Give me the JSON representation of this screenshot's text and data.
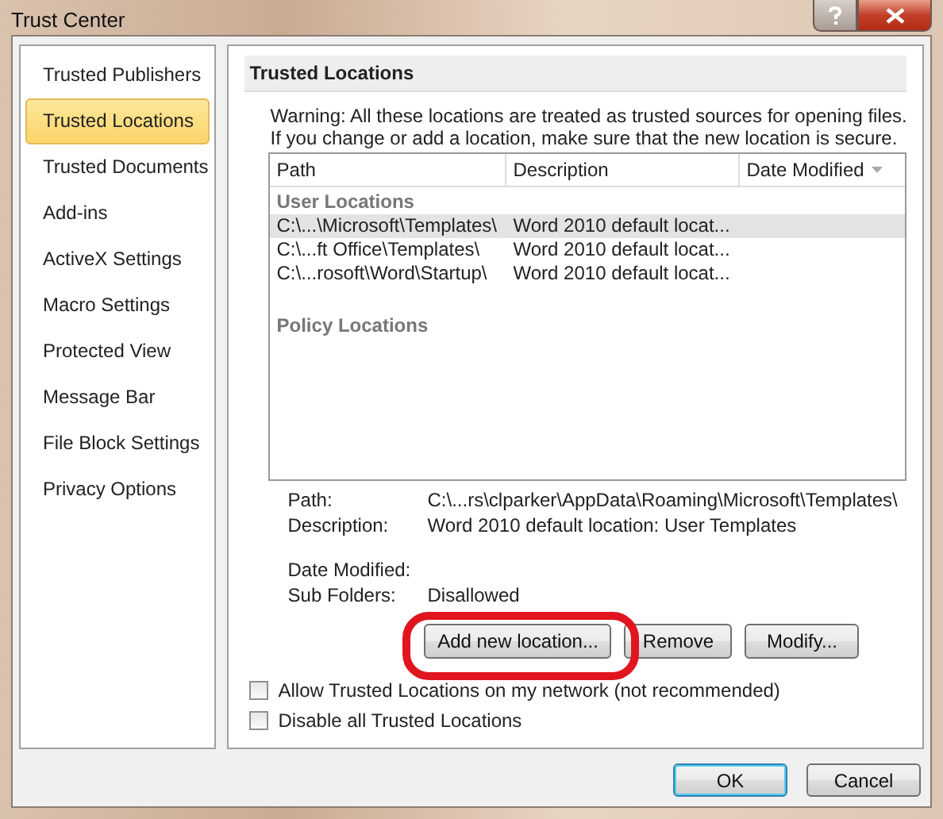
{
  "window": {
    "title": "Trust Center"
  },
  "sidebar": {
    "items": [
      {
        "label": "Trusted Publishers",
        "selected": false
      },
      {
        "label": "Trusted Locations",
        "selected": true
      },
      {
        "label": "Trusted Documents",
        "selected": false
      },
      {
        "label": "Add-ins",
        "selected": false
      },
      {
        "label": "ActiveX Settings",
        "selected": false
      },
      {
        "label": "Macro Settings",
        "selected": false
      },
      {
        "label": "Protected View",
        "selected": false
      },
      {
        "label": "Message Bar",
        "selected": false
      },
      {
        "label": "File Block Settings",
        "selected": false
      },
      {
        "label": "Privacy Options",
        "selected": false
      }
    ]
  },
  "section": {
    "title": "Trusted Locations",
    "warning": [
      "Warning: All these locations are treated as trusted sources for opening files.",
      "If you change or add a location, make sure that the new location is secure."
    ],
    "table": {
      "columns": [
        "Path",
        "Description",
        "Date Modified"
      ],
      "groups": [
        {
          "label": "User Locations",
          "rows": [
            {
              "path": "C:\\...\\Microsoft\\Templates\\",
              "description": "Word 2010 default locat...",
              "selected": true
            },
            {
              "path": "C:\\...ft Office\\Templates\\",
              "description": "Word 2010 default locat...",
              "selected": false
            },
            {
              "path": "C:\\...rosoft\\Word\\Startup\\",
              "description": "Word 2010 default locat...",
              "selected": false
            }
          ]
        },
        {
          "label": "Policy Locations"
        }
      ]
    },
    "details": [
      {
        "label": "Path:",
        "value": "C:\\...rs\\clparker\\AppData\\Roaming\\Microsoft\\Templates\\"
      },
      {
        "label": "Description:",
        "value": "Word 2010 default location: User Templates"
      },
      {
        "label": "Date Modified:"
      },
      {
        "label": "Sub Folders:",
        "value": "Disallowed"
      }
    ],
    "buttons": [
      "Add new location...",
      "Remove",
      "Modify..."
    ],
    "checkboxes": [
      {
        "label": "Allow Trusted Locations on my network (not recommended)",
        "checked": false
      },
      {
        "label": "Disable all Trusted Locations",
        "checked": false
      }
    ]
  },
  "footer": {
    "buttons": [
      {
        "label": "OK",
        "default": true
      },
      {
        "label": "Cancel",
        "default": false
      }
    ]
  }
}
